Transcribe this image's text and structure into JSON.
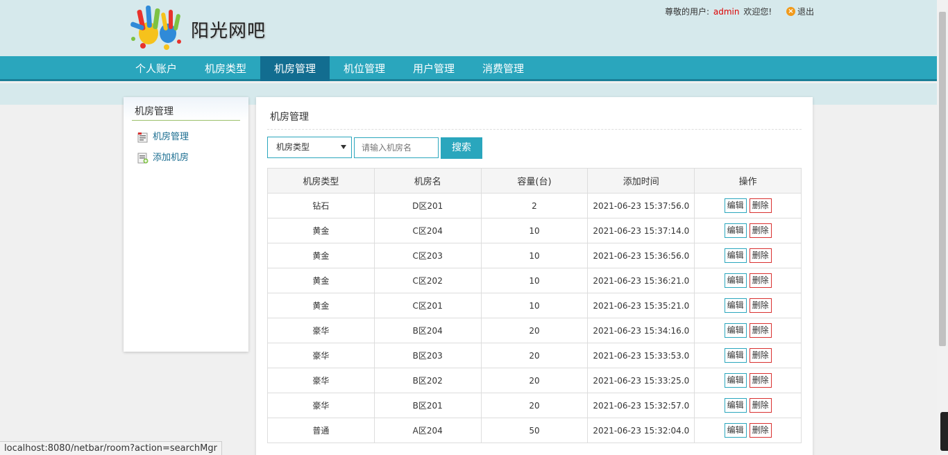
{
  "header": {
    "site_title": "阳光网吧",
    "greeting_prefix": "尊敬的用户:",
    "username": "admin",
    "greeting_suffix": "欢迎您!",
    "logout_label": "退出"
  },
  "nav": {
    "items": [
      {
        "label": "个人账户"
      },
      {
        "label": "机房类型"
      },
      {
        "label": "机房管理",
        "active": true
      },
      {
        "label": "机位管理"
      },
      {
        "label": "用户管理"
      },
      {
        "label": "消费管理"
      }
    ]
  },
  "sidebar": {
    "title": "机房管理",
    "links": [
      {
        "label": "机房管理",
        "icon": "list-icon"
      },
      {
        "label": "添加机房",
        "icon": "add-doc-icon"
      }
    ]
  },
  "main": {
    "title": "机房管理",
    "filter": {
      "type_select_value": "机房类型",
      "name_placeholder": "请输入机房名",
      "search_label": "搜索"
    },
    "table": {
      "columns": [
        "机房类型",
        "机房名",
        "容量(台)",
        "添加时间",
        "操作"
      ],
      "edit_label": "编辑",
      "delete_label": "删除",
      "rows": [
        {
          "type": "钻石",
          "name": "D区201",
          "capacity": "2",
          "time": "2021-06-23 15:37:56.0"
        },
        {
          "type": "黄金",
          "name": "C区204",
          "capacity": "10",
          "time": "2021-06-23 15:37:14.0"
        },
        {
          "type": "黄金",
          "name": "C区203",
          "capacity": "10",
          "time": "2021-06-23 15:36:56.0"
        },
        {
          "type": "黄金",
          "name": "C区202",
          "capacity": "10",
          "time": "2021-06-23 15:36:21.0"
        },
        {
          "type": "黄金",
          "name": "C区201",
          "capacity": "10",
          "time": "2021-06-23 15:35:21.0"
        },
        {
          "type": "豪华",
          "name": "B区204",
          "capacity": "20",
          "time": "2021-06-23 15:34:16.0"
        },
        {
          "type": "豪华",
          "name": "B区203",
          "capacity": "20",
          "time": "2021-06-23 15:33:53.0"
        },
        {
          "type": "豪华",
          "name": "B区202",
          "capacity": "20",
          "time": "2021-06-23 15:33:25.0"
        },
        {
          "type": "豪华",
          "name": "B区201",
          "capacity": "20",
          "time": "2021-06-23 15:32:57.0"
        },
        {
          "type": "普通",
          "name": "A区204",
          "capacity": "50",
          "time": "2021-06-23 15:32:04.0"
        }
      ]
    }
  },
  "status_bar": {
    "url": "localhost:8080/netbar/room?action=searchMgr"
  },
  "colors": {
    "nav_bg": "#2aa6bd",
    "nav_active": "#126d90",
    "header_bg": "#d6e9ec",
    "username_red": "#dd0000",
    "delete_border": "#d9302f"
  }
}
